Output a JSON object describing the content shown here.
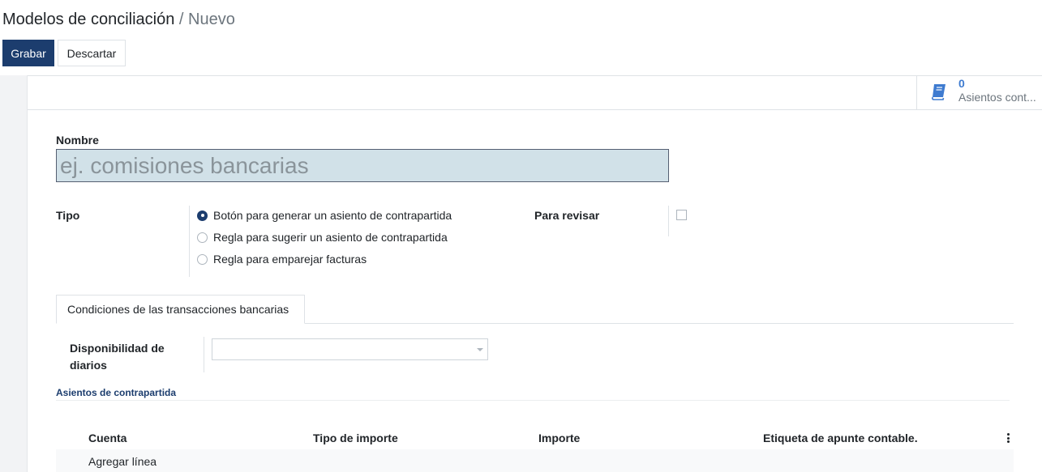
{
  "breadcrumb": {
    "parent": "Modelos de conciliación",
    "separator": " / ",
    "current": "Nuevo"
  },
  "actions": {
    "save_label": "Grabar",
    "discard_label": "Descartar"
  },
  "smart_button": {
    "count": "0",
    "label": "Asientos cont...",
    "icon": "book-icon",
    "color": "#3e7bd0"
  },
  "form": {
    "name_label": "Nombre",
    "name_placeholder": "ej. comisiones bancarias",
    "name_value": "",
    "type_label": "Tipo",
    "type_options": [
      {
        "label": "Botón para generar un asiento de contrapartida",
        "checked": true
      },
      {
        "label": "Regla para sugerir un asiento de contrapartida",
        "checked": false
      },
      {
        "label": "Regla para emparejar facturas",
        "checked": false
      }
    ],
    "to_check_label": "Para revisar",
    "to_check_value": false
  },
  "tabs": [
    {
      "label": "Condiciones de las transacciones bancarias",
      "active": true
    }
  ],
  "journal_availability": {
    "label_line1": "Disponibilidad de",
    "label_line2": "diarios",
    "value": ""
  },
  "counterpart": {
    "section_title": "Asientos de contrapartida",
    "columns": [
      "Cuenta",
      "Tipo de importe",
      "Importe",
      "Etiqueta de apunte contable."
    ],
    "add_line_label": "Agregar línea"
  },
  "colors": {
    "primary": "#1c3d6e",
    "input_bg": "#d1e1e8",
    "accent": "#3e7bd0"
  }
}
